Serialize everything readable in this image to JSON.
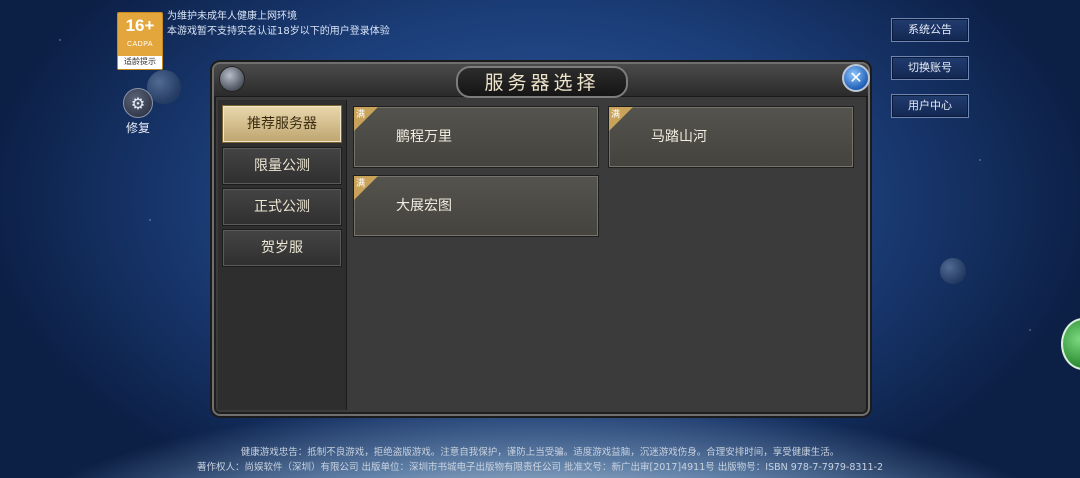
{
  "age_rating": {
    "age": "16+",
    "org": "CADPA",
    "tip": "适龄提示"
  },
  "notice": [
    "为维护未成年人健康上网环境",
    "本游戏暂不支持实名认证18岁以下的用户登录体验"
  ],
  "repair": {
    "label": "修复",
    "icon": "wrench-gear-icon"
  },
  "side_buttons": [
    "系统公告",
    "切换账号",
    "用户中心"
  ],
  "panel": {
    "title": "服务器选择",
    "close_icon": "close-x-icon",
    "categories": [
      "推荐服务器",
      "限量公测",
      "正式公测",
      "贺岁服"
    ],
    "active_category": "推荐服务器",
    "servers": [
      {
        "name": "鹏程万里",
        "status": "满"
      },
      {
        "name": "马踏山河",
        "status": "满"
      },
      {
        "name": "大展宏图",
        "status": "满"
      }
    ]
  },
  "footer": {
    "line1": "健康游戏忠告：抵制不良游戏，拒绝盗版游戏。注意自我保护，谨防上当受骗。适度游戏益脑，沉迷游戏伤身。合理安排时间，享受健康生活。",
    "line2": "著作权人：尚娱软件（深圳）有限公司 出版单位：深圳市书城电子出版物有限责任公司 批准文号：新广出审[2017]4911号 出版物号：ISBN 978-7-7979-8311-2"
  },
  "colors": {
    "accent_gold": "#c9a35a",
    "panel_bg": "#3b3b3b",
    "side_btn_bg": "#1a3262"
  }
}
